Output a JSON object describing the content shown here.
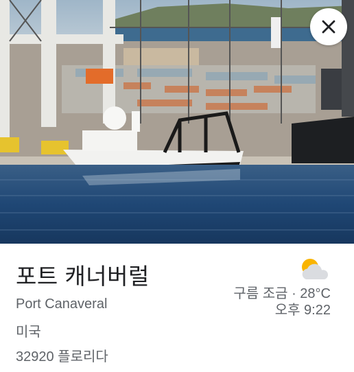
{
  "place": {
    "name_ko": "포트 캐너버럴",
    "name_en": "Port Canaveral",
    "country": "미국",
    "postal_region": "32920 플로리다"
  },
  "weather": {
    "icon": "partly-cloudy-icon",
    "condition_temp": "구름 조금 · 28°C",
    "time": "오후 9:22"
  },
  "controls": {
    "close_icon": "close-icon"
  },
  "colors": {
    "title": "#202124",
    "secondary_text": "#5f6368",
    "sun": "#f9b400",
    "cloud": "#dadce0"
  }
}
